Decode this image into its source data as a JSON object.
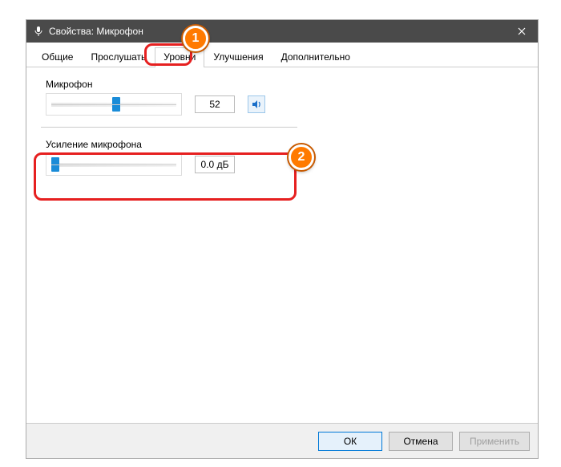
{
  "window": {
    "title": "Свойства: Микрофон"
  },
  "tabs": {
    "general": "Общие",
    "listen": "Прослушать",
    "levels": "Уровни",
    "enhancements": "Улучшения",
    "advanced": "Дополнительно"
  },
  "mic": {
    "label": "Микрофон",
    "value": "52",
    "slider_percent": 52
  },
  "boost": {
    "label": "Усиление микрофона",
    "value": "0.0 дБ",
    "slider_percent": 0
  },
  "buttons": {
    "ok": "ОК",
    "cancel": "Отмена",
    "apply": "Применить"
  },
  "callouts": {
    "one": "1",
    "two": "2"
  }
}
